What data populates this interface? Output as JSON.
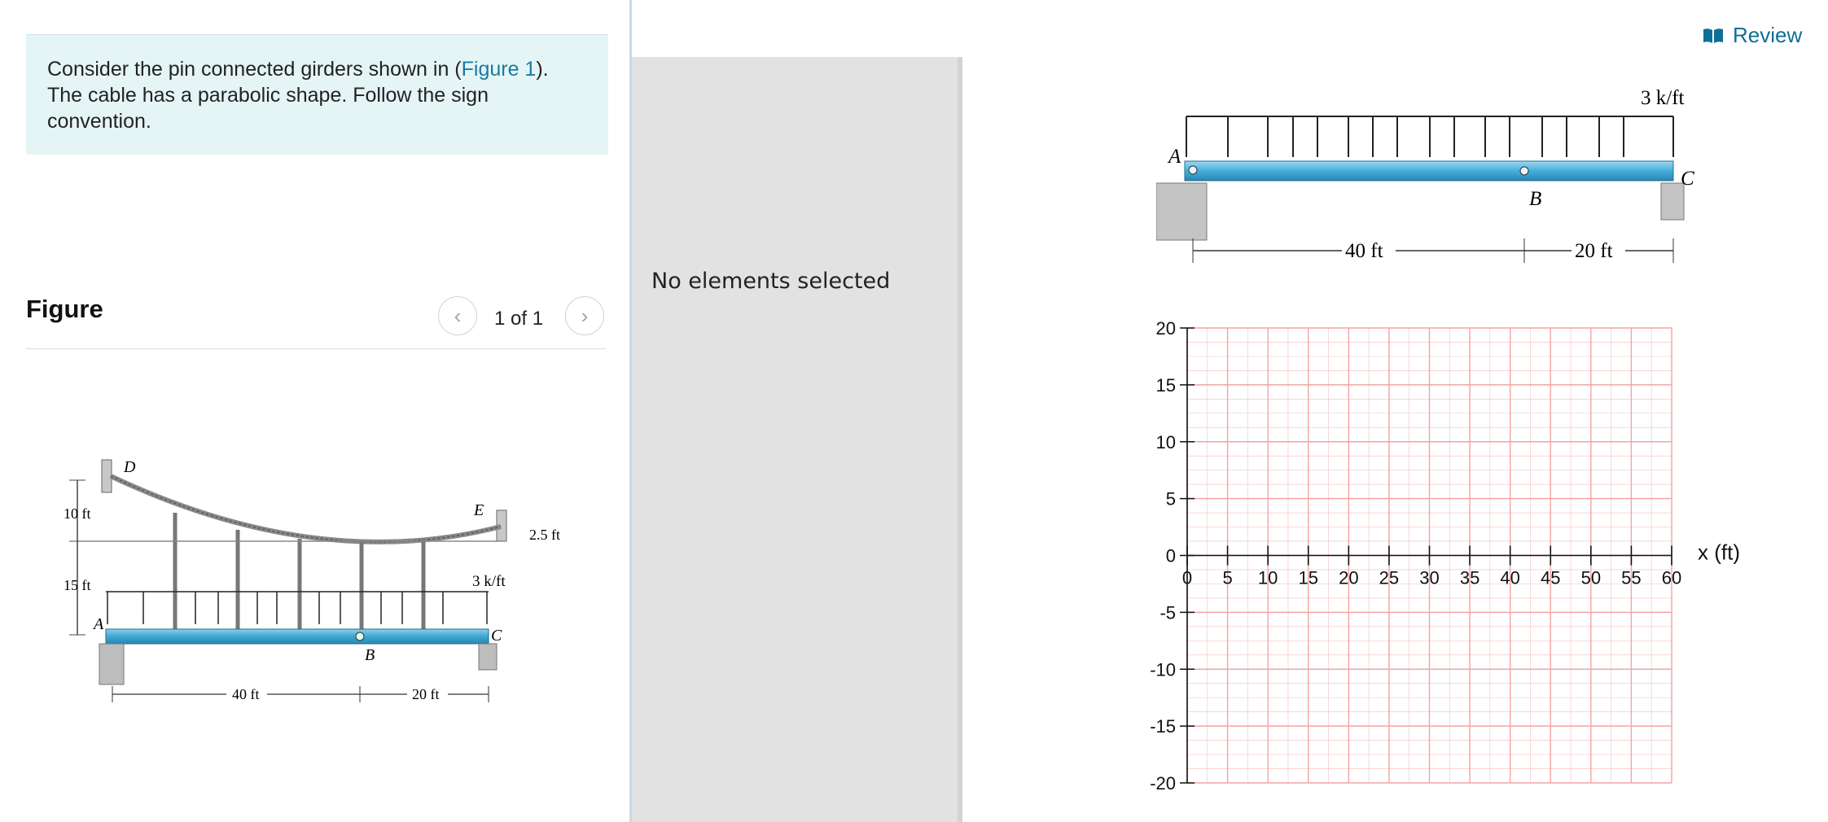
{
  "problem": {
    "text_before": "Consider the pin connected girders shown in (",
    "figure_link": "Figure 1",
    "text_after": "). The cable has a parabolic shape. Follow the sign convention."
  },
  "figure_panel": {
    "title": "Figure",
    "counter": "1 of 1",
    "prev_glyph": "‹",
    "next_glyph": "›",
    "labels": {
      "D": "D",
      "E": "E",
      "A": "A",
      "B": "B",
      "C": "C",
      "dim_10": "10 ft",
      "dim_15": "15 ft",
      "dim_25": "2.5 ft",
      "load": "3 k/ft",
      "span_40": "40 ft",
      "span_20": "20 ft"
    }
  },
  "middle_panel": {
    "status": "No elements selected"
  },
  "header": {
    "review_label": "Review",
    "review_icon": "book-icon"
  },
  "right_figure": {
    "load": "3 k/ft",
    "A": "A",
    "B": "B",
    "C": "C",
    "span_40": "40 ft",
    "span_20": "20 ft"
  },
  "chart_data": {
    "type": "line",
    "title": "",
    "xlabel": "x (ft)",
    "ylabel": "",
    "xlim": [
      0,
      60
    ],
    "ylim": [
      -20,
      20
    ],
    "x_ticks": [
      0,
      5,
      10,
      15,
      20,
      25,
      30,
      35,
      40,
      45,
      50,
      55,
      60
    ],
    "y_ticks": [
      20,
      15,
      10,
      5,
      0,
      -5,
      -10,
      -15,
      -20
    ],
    "grid": true,
    "grid_color": "#f5a3a3",
    "series": []
  }
}
